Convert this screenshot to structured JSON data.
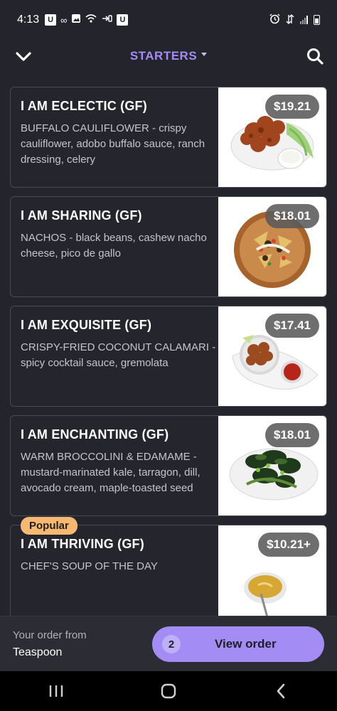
{
  "status_bar": {
    "time": "4:13",
    "icons_left": [
      "u-app-icon",
      "voicemail-icon",
      "image-icon",
      "wifi-calling-icon",
      "link-icon",
      "u-app-icon"
    ],
    "icons_right": [
      "alarm-icon",
      "data-transfer-icon",
      "signal-icon",
      "battery-icon"
    ]
  },
  "header": {
    "title": "STARTERS",
    "back_icon": "chevron-down-icon",
    "search_icon": "search-icon",
    "accent_color": "#a48cf5"
  },
  "menu": {
    "items": [
      {
        "title": "I AM ECLECTIC (GF)",
        "description": "BUFFALO CAULIFLOWER - crispy cauliflower, adobo buffalo sauce, ranch dressing, celery",
        "price": "$19.21"
      },
      {
        "title": "I AM SHARING (GF)",
        "description": "NACHOS - black beans, cashew nacho cheese, pico de gallo",
        "price": "$18.01"
      },
      {
        "title": "I AM EXQUISITE (GF)",
        "description": "CRISPY-FRIED COCONUT CALAMARI - spicy cocktail sauce, gremolata",
        "price": "$17.41"
      },
      {
        "title": "I AM ENCHANTING (GF)",
        "description": "WARM BROCCOLINI & EDAMAME - mustard-marinated kale, tarragon, dill, avocado cream, maple-toasted seed",
        "price": "$18.01"
      },
      {
        "badge": "Popular",
        "title": "I AM THRIVING (GF)",
        "description": "CHEF'S SOUP OF THE DAY",
        "price": "$10.21+"
      }
    ]
  },
  "order_bar": {
    "label": "Your order from",
    "restaurant": "Teaspoon",
    "count": "2",
    "button_label": "View order"
  },
  "nav_bar": {
    "buttons": [
      "recent-apps-icon",
      "home-icon",
      "back-icon"
    ]
  }
}
